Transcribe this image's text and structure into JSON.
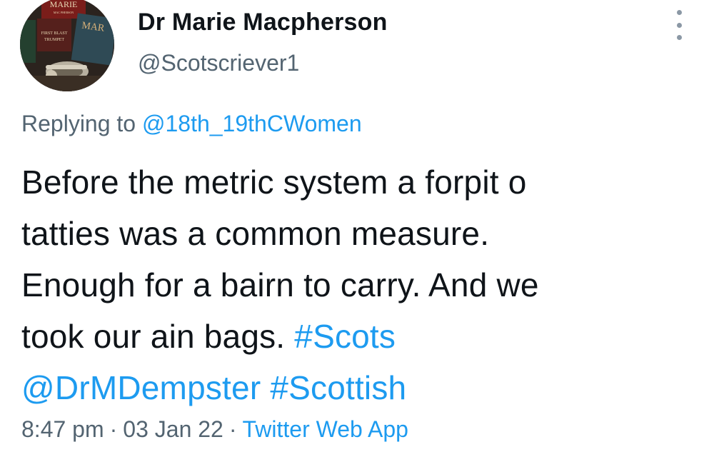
{
  "author": {
    "name": "Dr Marie Macpherson",
    "handle": "@Scotscriever1"
  },
  "avatar": {
    "book_title_top": "MARIE",
    "book_subtitle_top": "MAC PHERSON",
    "book_left_title": "FIRST BLAST",
    "book_left_subtitle": "TRUMPET",
    "book_right_title": "MAR"
  },
  "reply": {
    "prefix": "Replying to",
    "mention": "@18th_19thCWomen"
  },
  "tweet": {
    "line1": "Before the metric system a forpit o",
    "line2": "tatties was a common measure.",
    "line3": "Enough for a bairn to carry. And we",
    "line4_text": "took our ain bags.",
    "line4_hashtag": "#Scots",
    "line5_mention": "@DrMDempster",
    "line5_hashtag": "#Scottish"
  },
  "meta": {
    "time": "8:47 pm",
    "separator": "·",
    "date": "03 Jan 22",
    "source": "Twitter Web App"
  },
  "colors": {
    "link": "#1d9bf0",
    "secondary_text": "#536471",
    "primary_text": "#0f1419"
  },
  "icons": {
    "more": "more-vertical-icon"
  }
}
